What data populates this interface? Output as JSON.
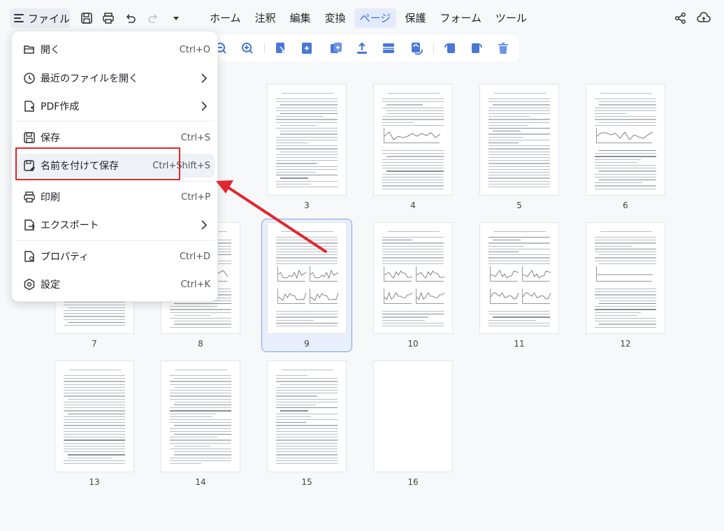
{
  "topbar": {
    "file_label": "ファイル",
    "nav_items": [
      "ホーム",
      "注釈",
      "編集",
      "変換",
      "ページ",
      "保護",
      "フォーム",
      "ツール"
    ],
    "active_nav": "ページ",
    "accent_color": "#3b6fd9"
  },
  "menu": {
    "items": [
      {
        "label": "開く",
        "shortcut": "Ctrl+O",
        "icon": "folder-open-icon"
      },
      {
        "label": "最近のファイルを開く",
        "shortcut": "",
        "icon": "clock-icon",
        "submenu": true
      },
      {
        "label": "PDF作成",
        "shortcut": "",
        "icon": "file-plus-icon",
        "submenu": true
      },
      {
        "label": "保存",
        "shortcut": "Ctrl+S",
        "icon": "save-icon"
      },
      {
        "label": "名前を付けて保存",
        "shortcut": "Ctrl+Shift+S",
        "icon": "save-as-icon",
        "highlighted": true
      },
      {
        "label": "印刷",
        "shortcut": "Ctrl+P",
        "icon": "printer-icon"
      },
      {
        "label": "エクスポート",
        "shortcut": "",
        "icon": "export-icon",
        "submenu": true
      },
      {
        "label": "プロパティ",
        "shortcut": "Ctrl+D",
        "icon": "properties-icon"
      },
      {
        "label": "設定",
        "shortcut": "Ctrl+K",
        "icon": "settings-icon"
      }
    ]
  },
  "pages": {
    "labels": [
      "3",
      "4",
      "5",
      "6",
      "7",
      "8",
      "9",
      "10",
      "11",
      "12",
      "13",
      "14",
      "15",
      "16"
    ],
    "selected": "9"
  },
  "annotation_color": "#e0272d"
}
